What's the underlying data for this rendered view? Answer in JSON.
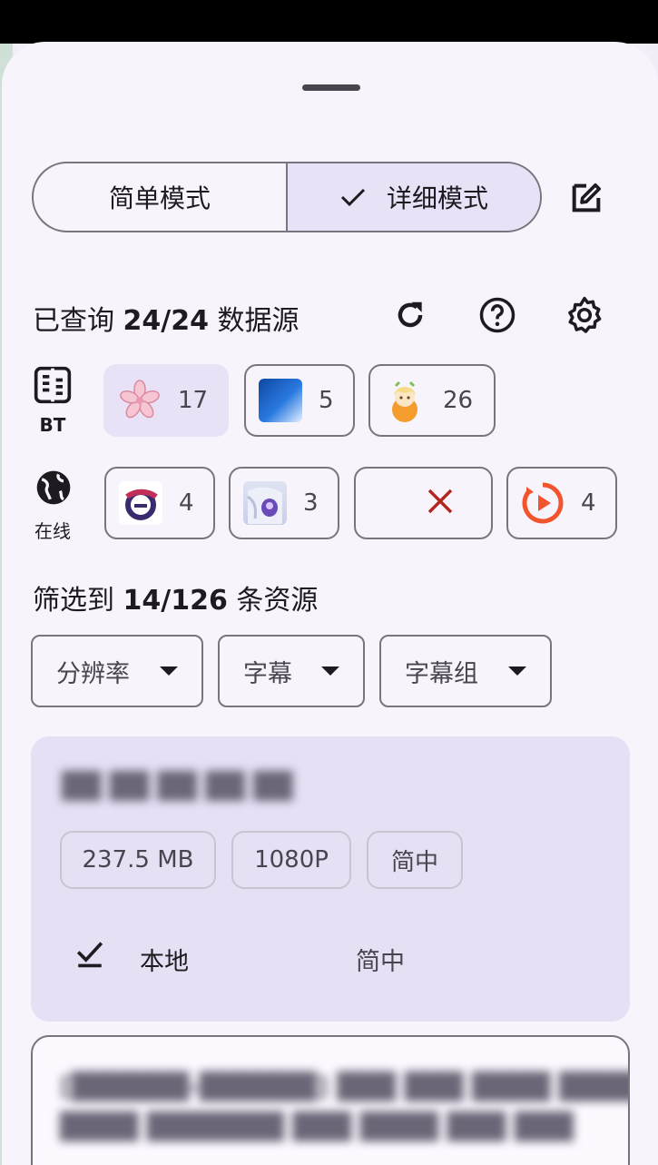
{
  "mode": {
    "simple": "简单模式",
    "detailed": "详细模式",
    "selected": "detailed"
  },
  "query": {
    "prefix": "已查询 ",
    "count": "24/24",
    "suffix": " 数据源"
  },
  "rows": {
    "bt": {
      "label": "BT",
      "sources": [
        {
          "name": "sakura-icon",
          "count": "17",
          "selected": true
        },
        {
          "name": "blue-sky-icon",
          "count": "5",
          "selected": false
        },
        {
          "name": "anime-girl-icon",
          "count": "26",
          "selected": false
        }
      ]
    },
    "online": {
      "label": "在线",
      "sources": [
        {
          "name": "purple-logo-icon",
          "count": "4"
        },
        {
          "name": "anime-eye-icon",
          "count": "3"
        },
        {
          "name": "error-x-icon",
          "count": ""
        },
        {
          "name": "orange-play-icon",
          "count": "4"
        }
      ]
    }
  },
  "filter": {
    "prefix": "筛选到 ",
    "count": "14/126",
    "suffix": " 条资源"
  },
  "dropdowns": [
    "分辨率",
    "字幕",
    "字幕组"
  ],
  "results": [
    {
      "title": "██ ██ ██ ██ ██",
      "tags": [
        "237.5 MB",
        "1080P",
        "简中"
      ],
      "location": "本地",
      "subtitle": "简中"
    },
    {
      "title_line1": "[██████-██████] ███ ███ ████ ████ ██",
      "title_line2": "████ ███████ ███ ████ ███ ███"
    }
  ],
  "colors": {
    "accent_bg": "#e9e1f6",
    "outline": "#79747e",
    "error": "#b3261e"
  }
}
